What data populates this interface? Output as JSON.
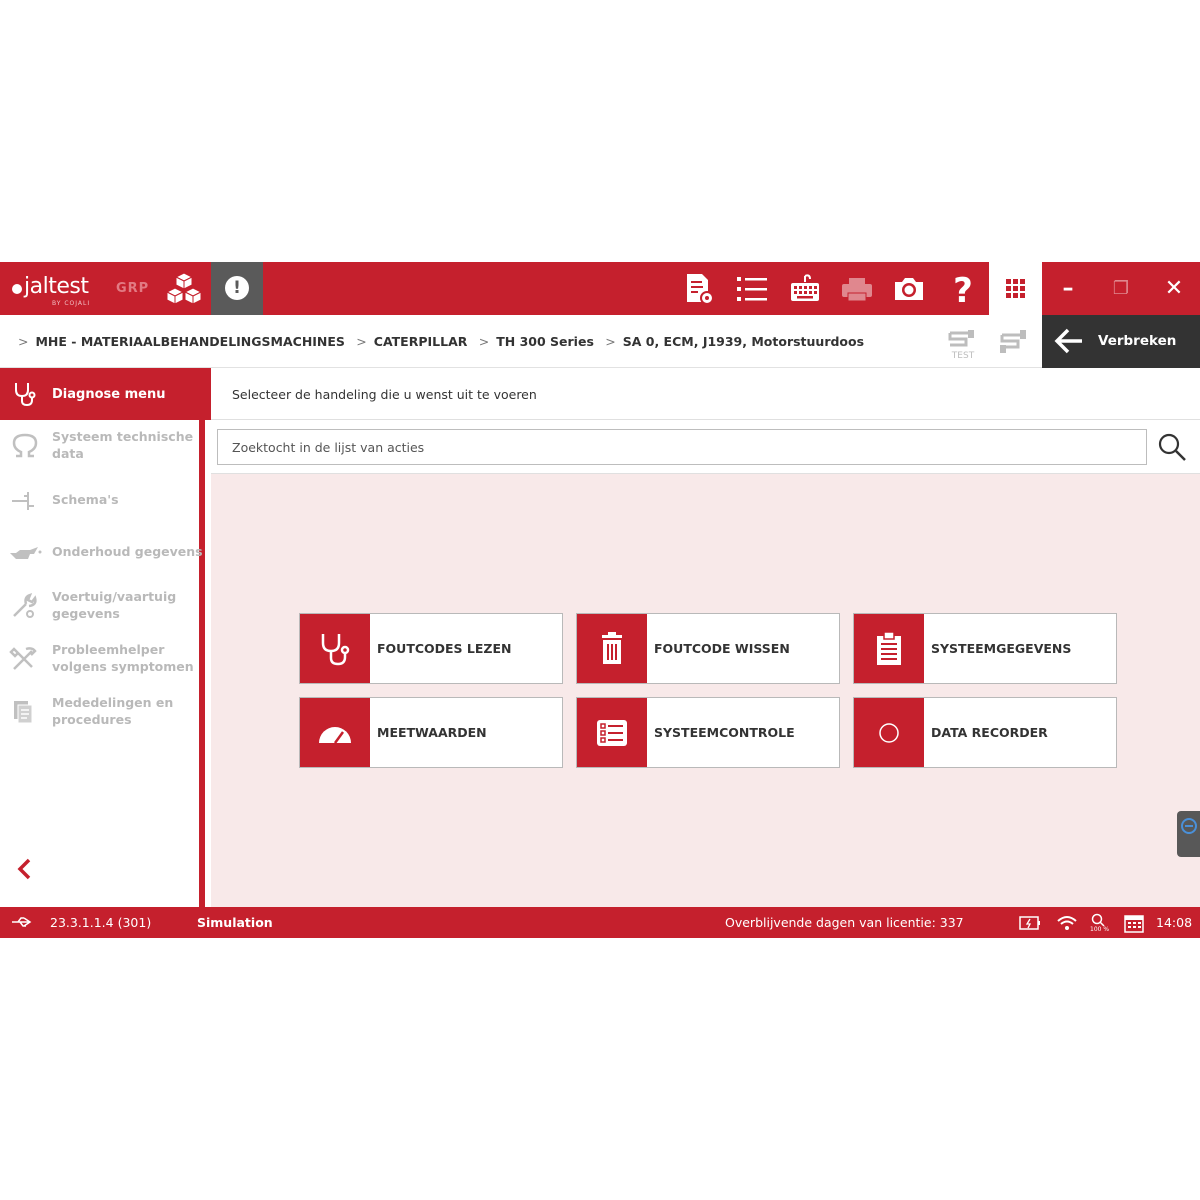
{
  "app": {
    "logo_text": "jaltest",
    "logo_subtext": "BY COJALI",
    "product": "GRP"
  },
  "toolbar": {
    "icons": [
      "report-icon",
      "list-icon",
      "keyboard-icon",
      "printer-icon",
      "camera-icon",
      "help-icon",
      "apps-grid-icon"
    ],
    "help_label": "?"
  },
  "window": {
    "minimize": "–",
    "restore": "❐",
    "close": "✕"
  },
  "breadcrumb": {
    "items": [
      "MHE - MATERIAALBEHANDELINGSMACHINES",
      "CATERPILLAR",
      "TH 300 Series",
      "SA 0, ECM, J1939, Motorstuurdoos"
    ]
  },
  "connection": {
    "test_label": "TEST",
    "disconnect_label": "Verbreken"
  },
  "sidebar": {
    "header": "Diagnose menu",
    "items": [
      {
        "label": "Systeem technische data",
        "icon": "omega-icon"
      },
      {
        "label": "Schema's",
        "icon": "schematic-icon"
      },
      {
        "label": "Onderhoud gegevens",
        "icon": "oil-can-icon"
      },
      {
        "label": "Voertuig/vaartuig gegevens",
        "icon": "wrench-icon"
      },
      {
        "label": "Probleemhelper volgens symptomen",
        "icon": "tools-icon"
      },
      {
        "label": "Mededelingen en procedures",
        "icon": "documents-icon"
      }
    ]
  },
  "main": {
    "prompt": "Selecteer de handeling die u wenst uit te voeren",
    "search_placeholder": "Zoektocht in de lijst van acties",
    "tiles": [
      {
        "label": "FOUTCODES LEZEN",
        "icon": "stethoscope-icon"
      },
      {
        "label": "FOUTCODE WISSEN",
        "icon": "trash-icon"
      },
      {
        "label": "SYSTEEMGEGEVENS",
        "icon": "clipboard-icon"
      },
      {
        "label": "MEETWAARDEN",
        "icon": "gauge-icon"
      },
      {
        "label": "SYSTEEMCONTROLE",
        "icon": "checklist-icon"
      },
      {
        "label": "DATA RECORDER",
        "icon": "record-icon"
      }
    ]
  },
  "status": {
    "version": "23.3.1.1.4 (301)",
    "mode": "Simulation",
    "license": "Overblijvende dagen van licentie: 337",
    "zoom": "100 %",
    "time": "14:08"
  },
  "colors": {
    "brand": "#c5202d",
    "dark": "#333333",
    "panel": "#f8e9e9"
  }
}
